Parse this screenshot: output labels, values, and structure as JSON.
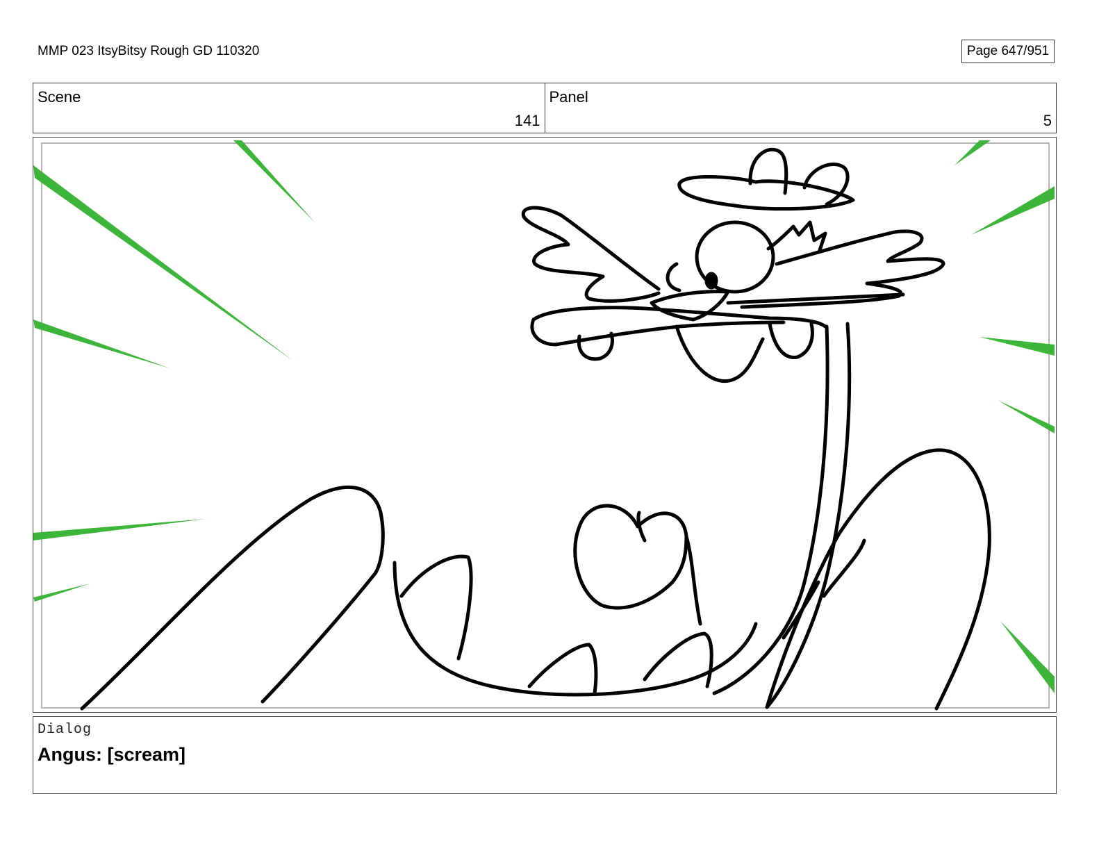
{
  "header": {
    "document_title": "MMP 023 ItsyBitsy Rough GD 110320",
    "page_indicator": "Page 647/951"
  },
  "info": {
    "scene_label": "Scene",
    "scene_value": "141",
    "panel_label": "Panel",
    "panel_value": "5"
  },
  "drawing": {
    "description_icon": "storyboard-sketch",
    "line_color": "#000000",
    "accent_color": "#3db53a"
  },
  "dialog": {
    "label": "Dialog",
    "line": "Angus: [scream]"
  }
}
